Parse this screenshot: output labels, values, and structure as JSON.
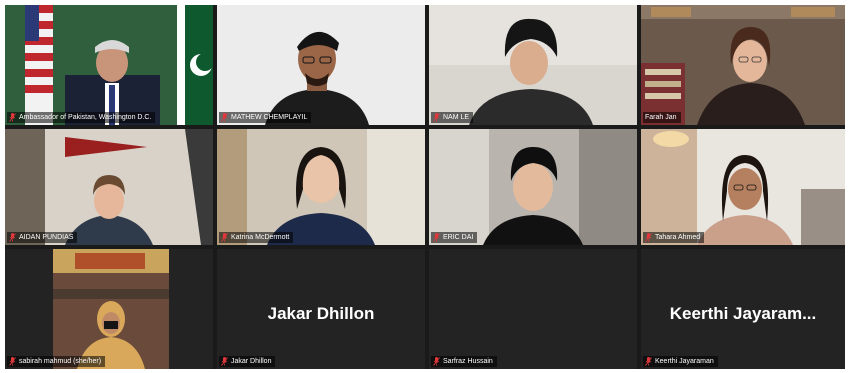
{
  "app": "Zoom gallery view",
  "colors": {
    "active_speaker_border": "#8fd14f",
    "muted_mic": "#e0383c",
    "tile_bg": "#232323"
  },
  "participants": [
    {
      "name": "Ambassador of Pakistan, Washington D.C.",
      "video": true,
      "muted": true
    },
    {
      "name": "MATHEW CHEMPLAYIL",
      "video": true,
      "muted": true
    },
    {
      "name": "NAM LE",
      "video": true,
      "muted": true
    },
    {
      "name": "Farah Jan",
      "video": true,
      "muted": false,
      "active_speaker": true
    },
    {
      "name": "AIDAN PUNDIAS",
      "video": true,
      "muted": true
    },
    {
      "name": "Katrina McDermott",
      "video": true,
      "muted": true
    },
    {
      "name": "ERIC DAI",
      "video": true,
      "muted": true
    },
    {
      "name": "Tahara Ahmed",
      "video": true,
      "muted": true
    },
    {
      "name": "sabirah mahmud (she/her)",
      "video": true,
      "muted": true
    },
    {
      "name": "Jakar Dhillon",
      "display_name": "Jakar Dhillon",
      "video": false,
      "muted": true
    },
    {
      "name": "Sarfraz Hussain",
      "video": false,
      "muted": true
    },
    {
      "name": "Keerthi Jayaraman",
      "display_name": "Keerthi  Jayaram...",
      "video": false,
      "muted": true
    }
  ]
}
